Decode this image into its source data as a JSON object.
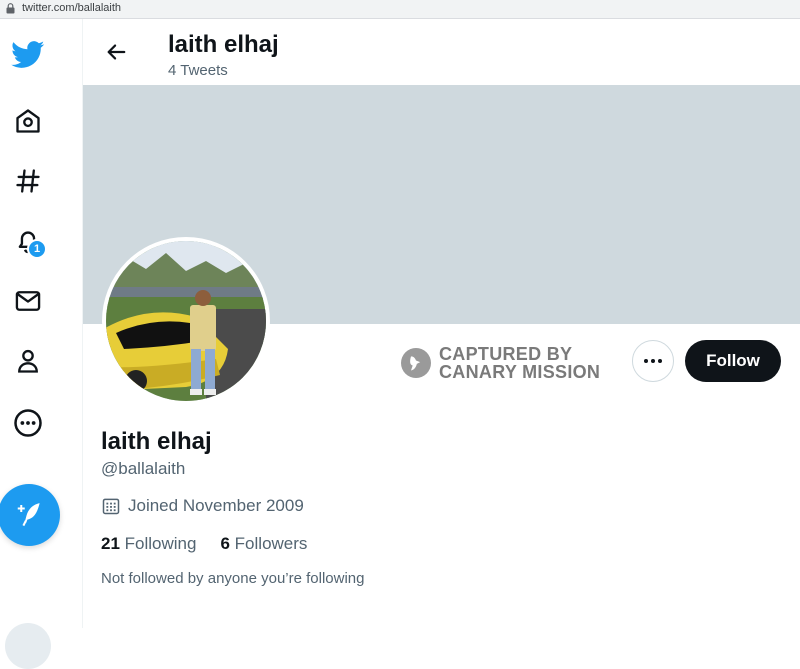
{
  "browser": {
    "url": "twitter.com/ballalaith"
  },
  "header": {
    "name": "laith elhaj",
    "tweet_count": "4 Tweets"
  },
  "sidebar": {
    "items": [
      {
        "name": "twitter-logo-icon"
      },
      {
        "name": "home-icon"
      },
      {
        "name": "explore-icon"
      },
      {
        "name": "notifications-icon",
        "badge": "1"
      },
      {
        "name": "messages-icon"
      },
      {
        "name": "profile-icon"
      },
      {
        "name": "more-icon"
      }
    ],
    "tweet_button_icon": "feather-plus-icon"
  },
  "watermark": {
    "line1": "CAPTURED BY",
    "line2": "CANARY MISSION"
  },
  "profile": {
    "name": "laith elhaj",
    "handle": "@ballalaith",
    "joined": "Joined November 2009",
    "following_count": "21",
    "following_label": "Following",
    "followers_count": "6",
    "followers_label": "Followers",
    "not_followed": "Not followed by anyone you’re following"
  },
  "actions": {
    "follow_label": "Follow"
  },
  "colors": {
    "accent": "#1d9bf0",
    "banner": "#cfd9de",
    "follow_bg": "#0f1419"
  }
}
